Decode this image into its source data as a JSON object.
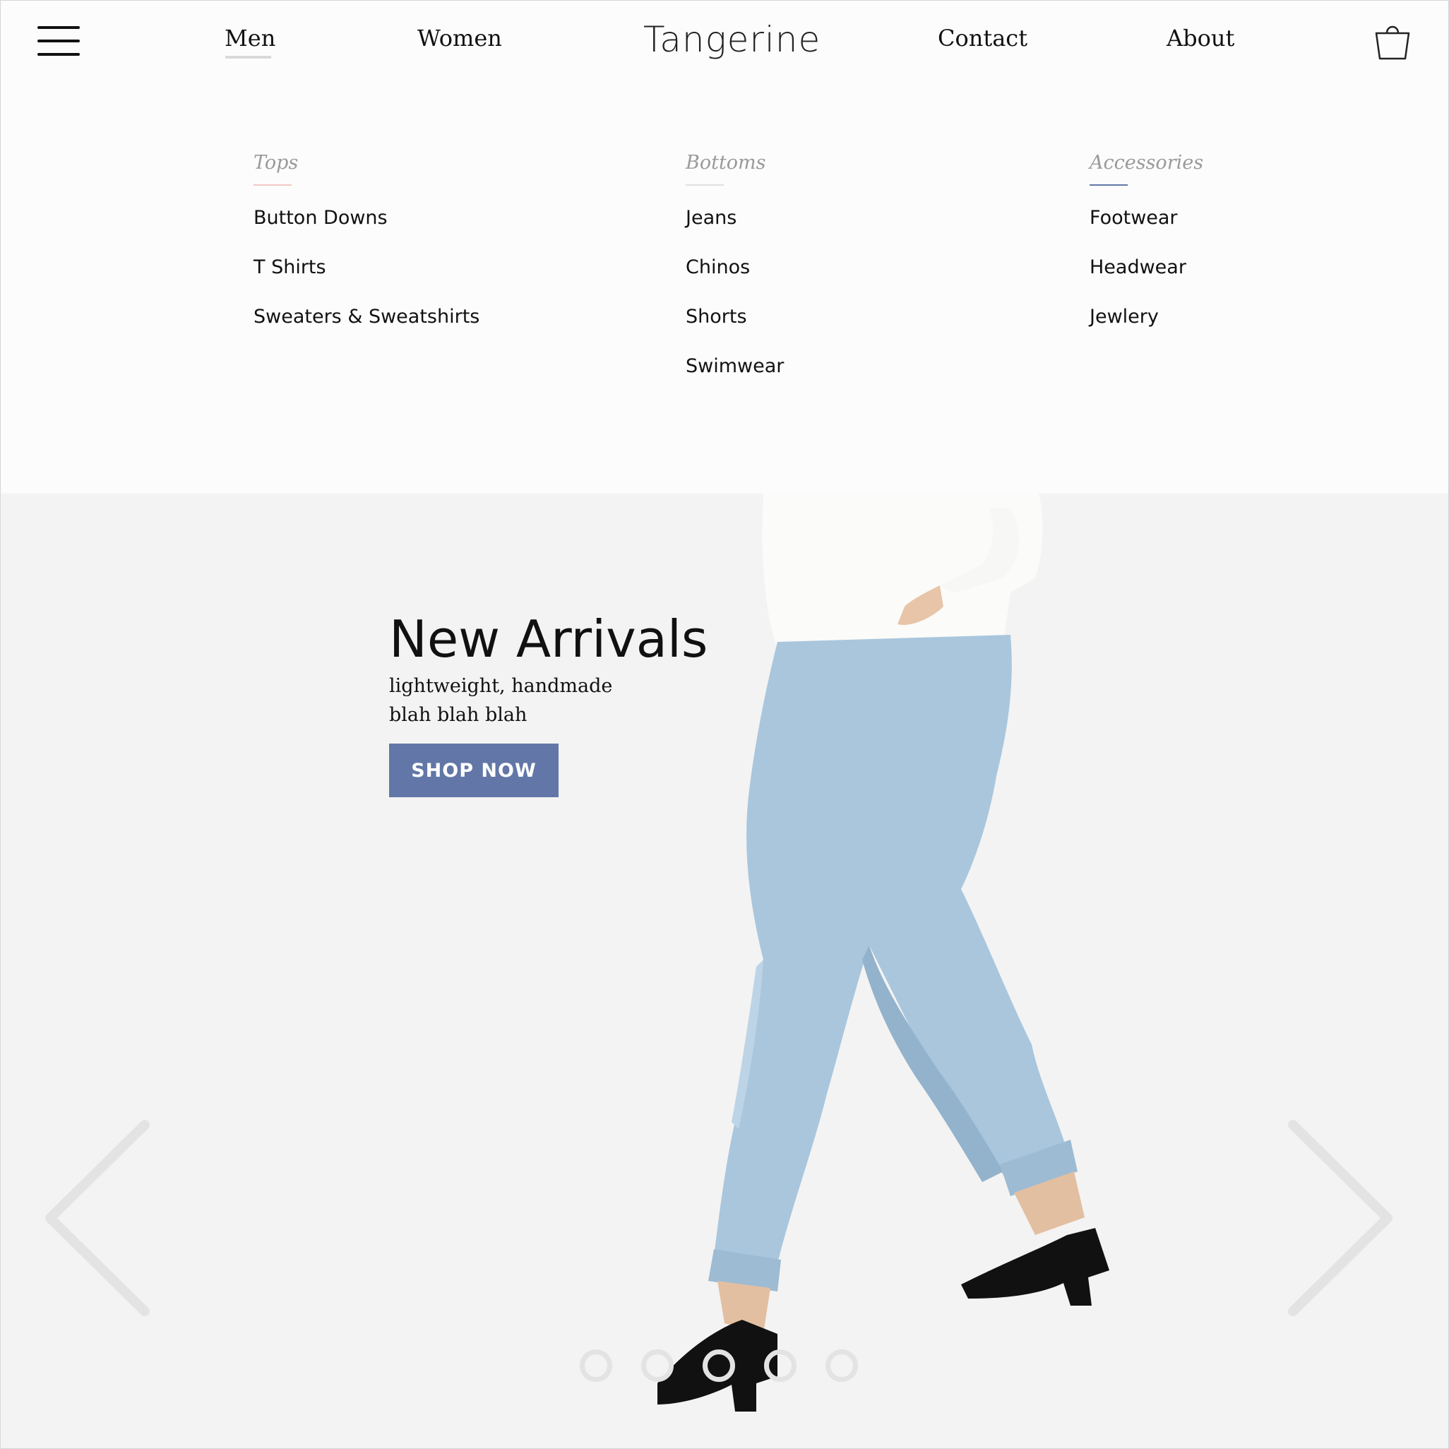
{
  "header": {
    "brand": "Tangerine",
    "nav": {
      "men": "Men",
      "women": "Women",
      "contact": "Contact",
      "about": "About"
    },
    "active_nav": "Men"
  },
  "mega_menu": {
    "columns": [
      {
        "title": "Tops",
        "accent": "#f2c9c2",
        "items": [
          "Button Downs",
          "T Shirts",
          "Sweaters & Sweatshirts"
        ]
      },
      {
        "title": "Bottoms",
        "accent": "#e0e0e0",
        "items": [
          "Jeans",
          "Chinos",
          "Shorts",
          "Swimwear"
        ]
      },
      {
        "title": "Accessories",
        "accent": "#6277a7",
        "items": [
          "Footwear",
          "Headwear",
          "Jewlery"
        ]
      }
    ]
  },
  "hero": {
    "title": "New Arrivals",
    "subtitle": "lightweight, handmade blah blah blah",
    "cta": "SHOP NOW",
    "cta_color": "#6277a7",
    "image": "model-walking-in-light-wash-jeans-and-black-heels",
    "slide_count": 5
  },
  "colors": {
    "background": "#f3f3f3",
    "header_bg": "#fcfcfc",
    "accent": "#6277a7",
    "arrow": "#e3e3e3"
  }
}
